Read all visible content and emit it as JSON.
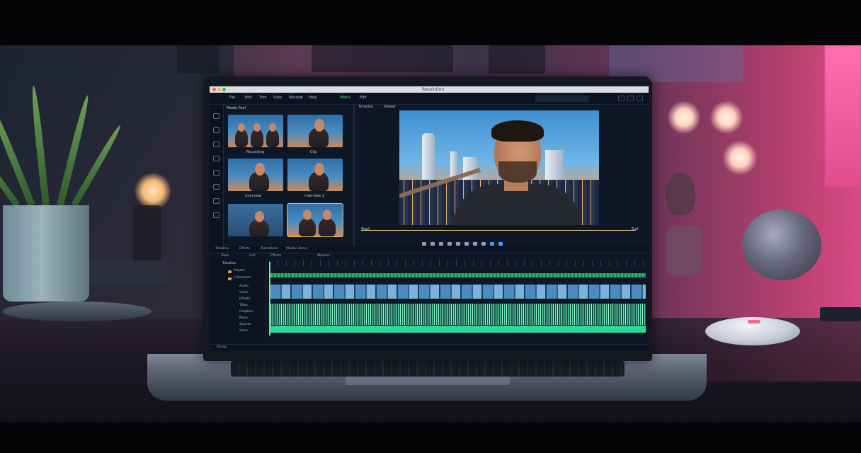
{
  "editor": {
    "window_title": "Resolution",
    "menu": [
      "File",
      "Edit",
      "Trim",
      "View",
      "Window",
      "Help"
    ],
    "menu_extra": [
      "Media",
      "Edit"
    ],
    "media_panel_title": "Media Pool",
    "thumbnails": [
      {
        "label": "Recording",
        "people": 3,
        "selected": false
      },
      {
        "label": "Clip",
        "people": 1,
        "selected": false
      },
      {
        "label": "Interview",
        "people": 1,
        "selected": false
      },
      {
        "label": "Interview 2",
        "people": 1,
        "selected": false
      },
      {
        "label": "",
        "people": 1,
        "selected": false
      },
      {
        "label": "",
        "people": 2,
        "selected": true
      }
    ],
    "preview_tabs": [
      "Timeline",
      "Viewer"
    ],
    "scrub_start": "Start",
    "scrub_end": "End",
    "tabs": [
      "Timeline",
      "Effects",
      "Transitions",
      "Media Library"
    ],
    "toolbar_labels": [
      "Tools",
      "Edit",
      "Effects",
      "Markers"
    ],
    "project_tree": {
      "root": "Timeline",
      "items": [
        "Project",
        "Collections",
        "Audio",
        "Video",
        "Effects",
        "Titles",
        "Graphics",
        "Music",
        "Sounds",
        "Voice"
      ]
    },
    "footer": "Ready",
    "colors": {
      "accent_blue": "#3fa0ff",
      "audio_green": "#2fd59a",
      "selection": "#e9b84a"
    }
  }
}
